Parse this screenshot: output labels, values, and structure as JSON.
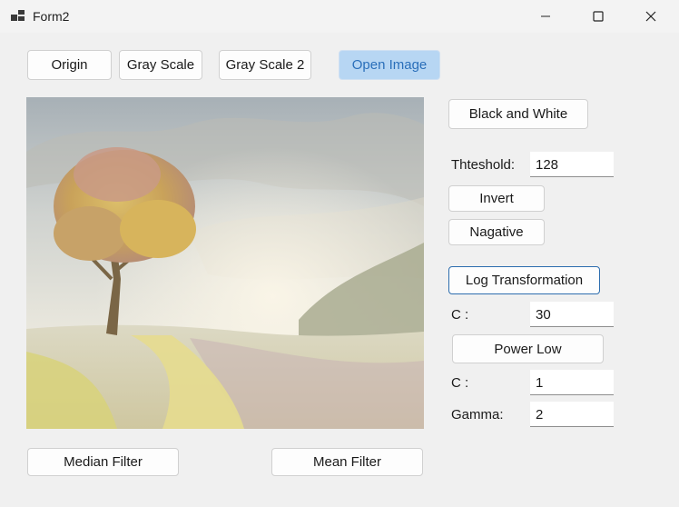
{
  "window": {
    "title": "Form2"
  },
  "toolbar": {
    "origin_label": "Origin",
    "gray_scale_label": "Gray Scale",
    "gray_scale_2_label": "Gray Scale 2",
    "open_image_label": "Open Image"
  },
  "controls": {
    "black_and_white_label": "Black and White",
    "threshold_label": "Thteshold:",
    "threshold_value": "128",
    "invert_label": "Invert",
    "negative_label": "Nagative",
    "log_transformation_label": "Log Transformation",
    "log_c_label": "C :",
    "log_c_value": "30",
    "power_low_label": "Power Low",
    "power_c_label": "C :",
    "power_c_value": "1",
    "gamma_label": "Gamma:",
    "gamma_value": "2"
  },
  "filters": {
    "median_label": "Median Filter",
    "mean_label": "Mean Filter"
  },
  "colors": {
    "accent_button": "#b7d6f3",
    "focus_border": "#2d6dae"
  }
}
